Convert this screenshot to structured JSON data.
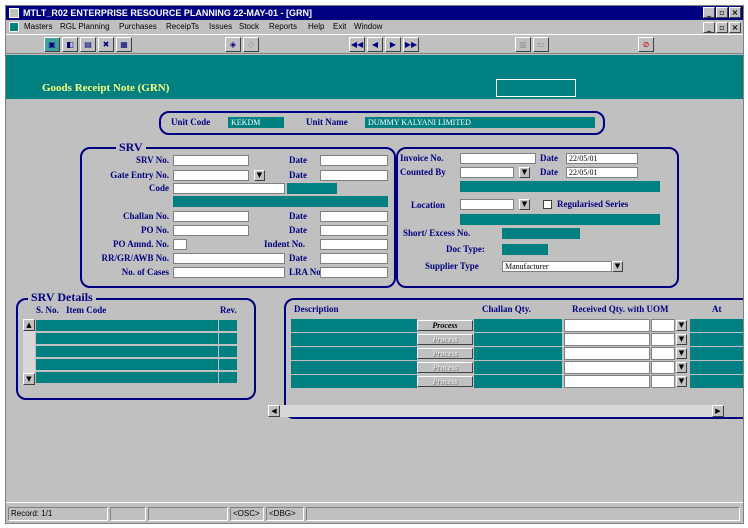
{
  "window": {
    "title": "MTLT_R02  ENTERPRISE RESOURCE PLANNING      22-MAY-01 - [GRN]"
  },
  "menu": [
    "Masters",
    "RGL Planning",
    "Purchases",
    "ReceipTs",
    "Issues",
    "Stock",
    "Reports",
    "Help",
    "Exit",
    "Window"
  ],
  "form": {
    "title": "Goods Receipt Note (GRN)"
  },
  "unit": {
    "code_label": "Unit Code",
    "code_value": "KEKDM",
    "name_label": "Unit Name",
    "name_value": "DUMMY KALYANI LIMITED"
  },
  "srv": {
    "section_title": "SRV",
    "srv_no": "SRV No.",
    "date": "Date",
    "gate_entry_no": "Gate Entry No.",
    "code": "Code",
    "challan_no": "Challan No.",
    "po_no": "PO No.",
    "po_amnd_no": "PO Amnd. No.",
    "indent_no": "Indent No.",
    "rr_gr_awb_no": "RR/GR/AWB No.",
    "no_of_cases": "No. of Cases",
    "lra_no": "LRA No."
  },
  "invoice": {
    "invoice_no": "Invoice No.",
    "date": "Date",
    "invoice_date": "22/05/01",
    "counted_by": "Counted By",
    "counted_date": "22/05/01",
    "location": "Location",
    "regularised_series": "Regularised Series",
    "short_excess_no": "Short/ Excess No.",
    "doc_type": "Doc Type:",
    "supplier_type": "Supplier Type",
    "supplier_type_value": "Manufacturer"
  },
  "srv_details": {
    "section_title": "SRV Details",
    "col_sno": "S. No.",
    "col_item_code": "Item Code",
    "col_rev": "Rev."
  },
  "detail_grid": {
    "col_description": "Description",
    "col_challan_qty": "Challan Qty.",
    "col_received_qty": "Received Qty. with UOM",
    "col_at": "At",
    "process_label": "Process"
  },
  "status": {
    "record": "Record: 1/1",
    "osc": "<OSC>",
    "dbg": "<DBG>"
  }
}
